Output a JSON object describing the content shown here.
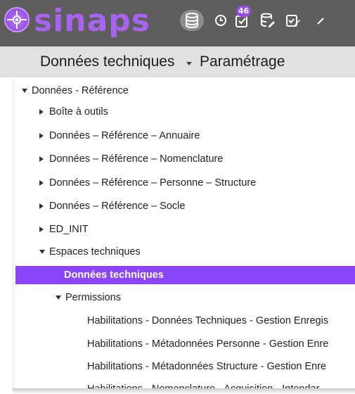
{
  "header": {
    "app_name": "sinaps",
    "logo_icon": "network-hub-icon",
    "toolbar": [
      {
        "name": "database-icon",
        "active": true
      },
      {
        "name": "clock-icon",
        "active": false
      },
      {
        "name": "task-check-icon",
        "active": false,
        "badge": "46"
      },
      {
        "name": "database-edit-icon",
        "active": false
      },
      {
        "name": "form-edit-icon",
        "active": false
      }
    ]
  },
  "titlebar": {
    "title": "Données techniques",
    "subtitle": "Paramétrage"
  },
  "tree": [
    {
      "label": "Données - Référence",
      "level": 0,
      "state": "expanded"
    },
    {
      "label": "Boîte à outils",
      "level": 1,
      "state": "collapsed"
    },
    {
      "label": "Données – Référence – Annuaire",
      "level": 1,
      "state": "collapsed"
    },
    {
      "label": "Données – Référence – Nomenclature",
      "level": 1,
      "state": "collapsed"
    },
    {
      "label": "Données – Référence – Personne – Structure",
      "level": 1,
      "state": "collapsed"
    },
    {
      "label": "Données – Référence – Socle",
      "level": 1,
      "state": "collapsed"
    },
    {
      "label": "ED_INIT",
      "level": 1,
      "state": "collapsed"
    },
    {
      "label": "Espaces techniques",
      "level": 1,
      "state": "expanded"
    },
    {
      "label": "Données techniques",
      "level": 2,
      "state": "leaf",
      "selected": true
    },
    {
      "label": "Permissions",
      "level": 2,
      "state": "expanded"
    },
    {
      "label": "Habilitations - Données Techniques - Gestion Enregis",
      "level": 3,
      "state": "leaf"
    },
    {
      "label": "Habilitations - Métadonnées Personne - Gestion Enre",
      "level": 3,
      "state": "leaf"
    },
    {
      "label": "Habilitations - Métadonnées Structure - Gestion Enre",
      "level": 3,
      "state": "leaf"
    },
    {
      "label": "Habilitations - Nomenclature - Acquisition - Intendar",
      "level": 3,
      "state": "leaf"
    }
  ],
  "colors": {
    "header_bg": "#5e5e5e",
    "brand_purple": "#a864f0",
    "selection": "#8b44f7",
    "titlebar_bg": "#e1e1e1"
  }
}
